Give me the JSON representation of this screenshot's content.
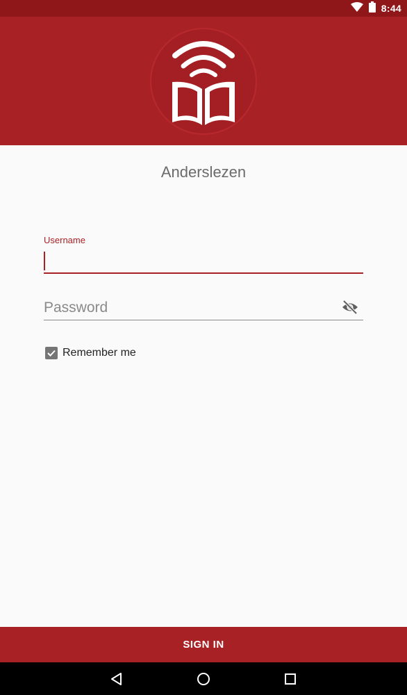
{
  "status_bar": {
    "time": "8:44",
    "icons": [
      "wifi-icon",
      "battery-icon"
    ]
  },
  "header": {
    "logo_icon": "wireless-book-logo-icon"
  },
  "app": {
    "title": "Anderslezen"
  },
  "form": {
    "username_label": "Username",
    "username_value": "",
    "password_placeholder": "Password",
    "password_value": "",
    "visibility_icon": "visibility-off-icon",
    "remember_label": "Remember me",
    "remember_checked": true,
    "sign_in_label": "SIGN IN"
  },
  "nav_bar": {
    "icons": [
      "back-icon",
      "home-icon",
      "recents-icon"
    ]
  },
  "colors": {
    "primary": "#a82125",
    "primary_dark": "#8f1719",
    "background": "#fafafa",
    "checkbox": "#757575"
  }
}
